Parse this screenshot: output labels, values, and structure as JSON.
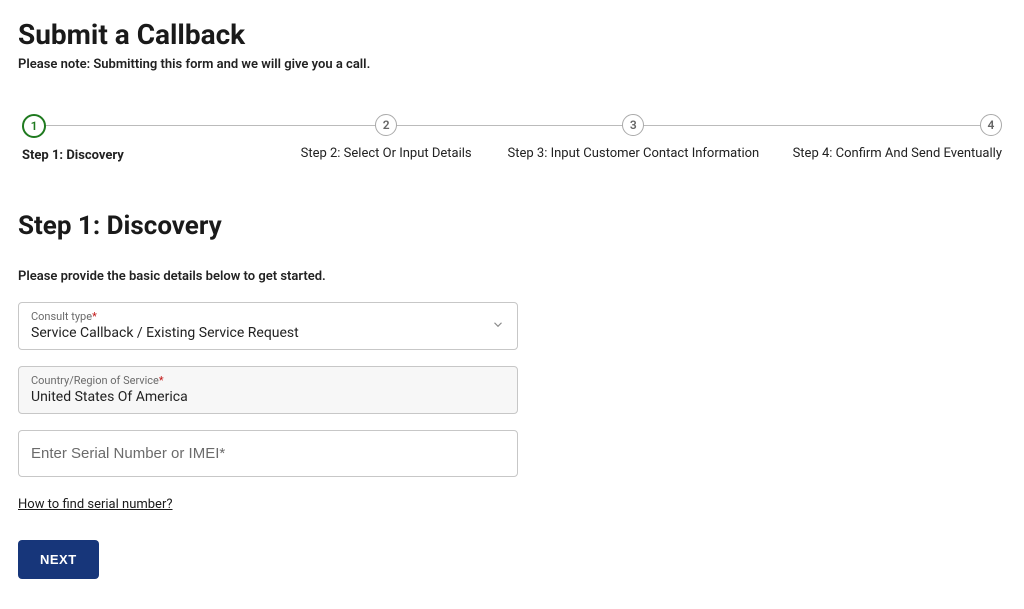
{
  "header": {
    "title": "Submit a Callback",
    "note": "Please note: Submitting this form and we will give you a call."
  },
  "stepper": {
    "active_index": 0,
    "steps": [
      {
        "num": "1",
        "label": "Step 1: Discovery"
      },
      {
        "num": "2",
        "label": "Step 2: Select Or Input Details"
      },
      {
        "num": "3",
        "label": "Step 3: Input Customer Contact Information"
      },
      {
        "num": "4",
        "label": "Step 4: Confirm And Send Eventually"
      }
    ]
  },
  "section": {
    "title": "Step 1: Discovery",
    "intro": "Please provide the basic details below to get started."
  },
  "form": {
    "consult_type": {
      "label": "Consult type",
      "required_mark": "*",
      "value": "Service Callback / Existing Service Request"
    },
    "country": {
      "label": "Country/Region of Service",
      "required_mark": "*",
      "value": "United States Of America"
    },
    "serial": {
      "placeholder": "Enter Serial Number or IMEI*",
      "value": ""
    },
    "serial_help_link": "How to find serial number?",
    "next_button": "NEXT"
  }
}
